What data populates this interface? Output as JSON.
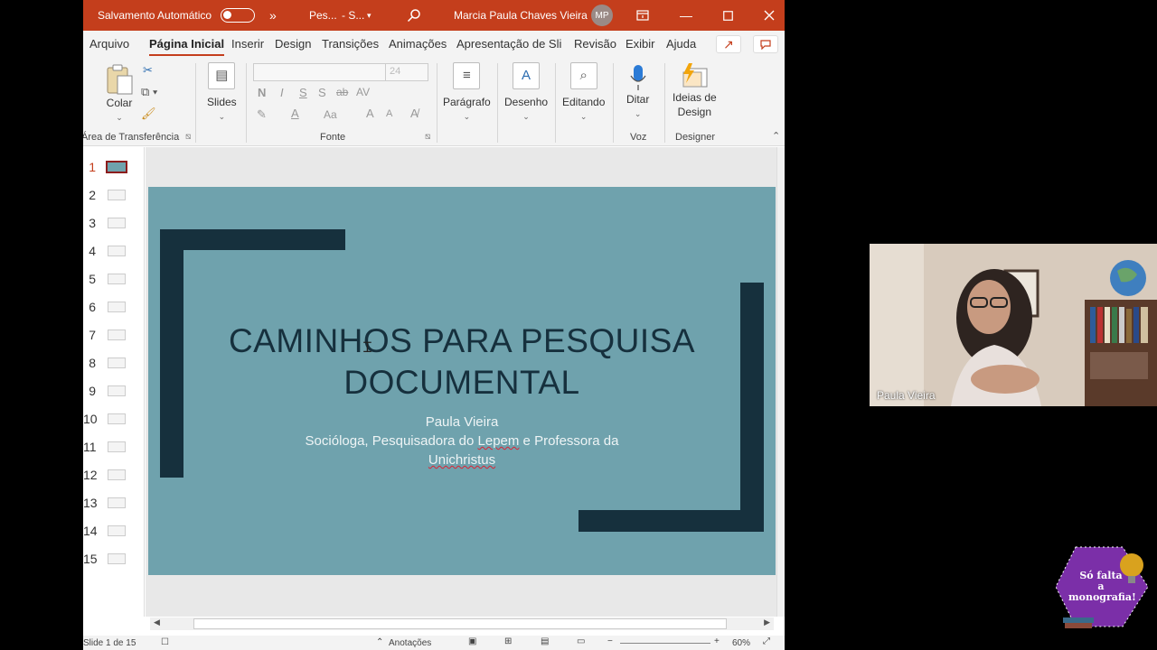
{
  "titlebar": {
    "autosave_label": "Salvamento Automático",
    "overflow": "»",
    "file_name": "Pes...",
    "file_location": "- S...",
    "user_name": "Marcia Paula Chaves Vieira",
    "user_initials": "MP"
  },
  "menu": {
    "tabs": [
      "Arquivo",
      "Página Inicial",
      "Inserir",
      "Design",
      "Transições",
      "Animações",
      "Apresentação de Sli",
      "Revisão",
      "Exibir",
      "Ajuda"
    ]
  },
  "ribbon": {
    "paste_label": "Colar",
    "clipboard_group": "Área de Transferência",
    "slides_label": "Slides",
    "font_size": "24",
    "font_group": "Fonte",
    "bold": "N",
    "italic": "I",
    "underline": "S",
    "shadow": "S",
    "strike": "ab",
    "spacing": "AV",
    "font_color": "A",
    "case": "Aa",
    "grow": "A",
    "shrink": "A",
    "paragraph_label": "Parágrafo",
    "drawing_label": "Desenho",
    "editing_label": "Editando",
    "dictate_label": "Ditar",
    "voice_group": "Voz",
    "design_ideas_line1": "Ideias de",
    "design_ideas_line2": "Design",
    "designer_group": "Designer"
  },
  "thumbnails": [
    "1",
    "2",
    "3",
    "4",
    "5",
    "6",
    "7",
    "8",
    "9",
    "10",
    "11",
    "12",
    "13",
    "14",
    "15"
  ],
  "slide": {
    "title_line1": "CAMINHOS PARA PESQUISA",
    "title_line2": "DOCUMENTAL",
    "subtitle_line1": "Paula Vieira",
    "subtitle_line2_a": "Socióloga, Pesquisadora do ",
    "subtitle_line2_b": "Lepem",
    "subtitle_line2_c": " e Professora da",
    "subtitle_line3": "Unichristus"
  },
  "statusbar": {
    "slide_counter": "Slide 1 de 15",
    "notes": "Anotações",
    "zoom": "60%"
  },
  "webcam": {
    "participant_name": "Paula Vieira"
  },
  "logo": {
    "line1": "Só falta",
    "line2": "a",
    "line3": "monografia!"
  },
  "colors": {
    "accent": "#c43e1c",
    "slide_bg": "#6fa2ad",
    "slide_dark": "#16303d",
    "logo_purple": "#7b2fa8"
  }
}
